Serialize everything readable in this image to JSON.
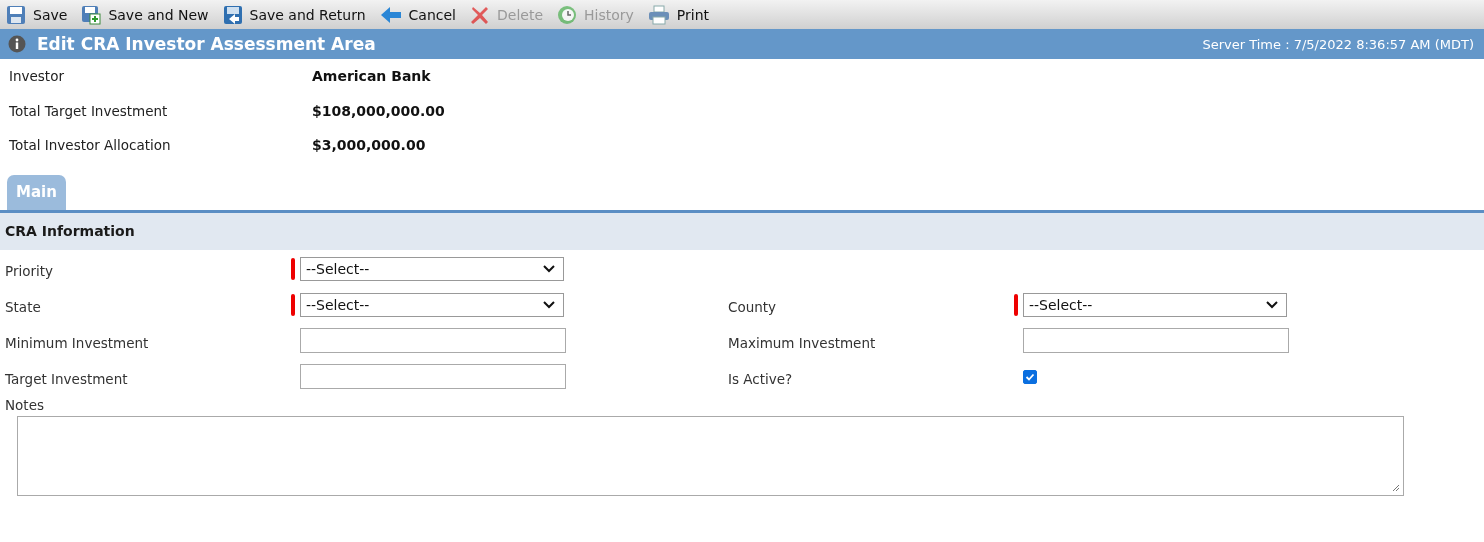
{
  "toolbar": [
    {
      "kind": "save",
      "label": "Save",
      "disabled": false
    },
    {
      "kind": "save-new",
      "label": "Save and New",
      "disabled": false
    },
    {
      "kind": "save-return",
      "label": "Save and Return",
      "disabled": false
    },
    {
      "kind": "cancel",
      "label": "Cancel",
      "disabled": false
    },
    {
      "kind": "delete",
      "label": "Delete",
      "disabled": true
    },
    {
      "kind": "history",
      "label": "History",
      "disabled": true
    },
    {
      "kind": "print",
      "label": "Print",
      "disabled": false
    }
  ],
  "header": {
    "title": "Edit CRA Investor Assessment Area",
    "server_time": "Server Time : 7/5/2022 8:36:57 AM (MDT)"
  },
  "summary": [
    {
      "label": "Investor",
      "value": "American Bank"
    },
    {
      "label": "Total Target Investment",
      "value": "$108,000,000.00"
    },
    {
      "label": "Total Investor Allocation",
      "value": "$3,000,000.00"
    }
  ],
  "tabs": [
    {
      "label": "Main",
      "selected": true
    }
  ],
  "section": {
    "title": "CRA Information"
  },
  "rows": [
    [
      {
        "label": "Priority",
        "kind": "select",
        "required": true,
        "value": "--Select--"
      }
    ],
    [
      {
        "label": "State",
        "kind": "select",
        "required": true,
        "value": "--Select--"
      },
      {
        "label": "County",
        "kind": "select",
        "required": true,
        "value": "--Select--"
      }
    ],
    [
      {
        "label": "Minimum Investment",
        "kind": "text",
        "required": false
      },
      {
        "label": "Maximum Investment",
        "kind": "text",
        "required": false
      }
    ],
    [
      {
        "label": "Target Investment",
        "kind": "text",
        "required": false
      },
      {
        "label": "Is Active?",
        "kind": "checkbox",
        "required": false,
        "checked": true
      }
    ]
  ],
  "notes": {
    "label": "Notes"
  }
}
